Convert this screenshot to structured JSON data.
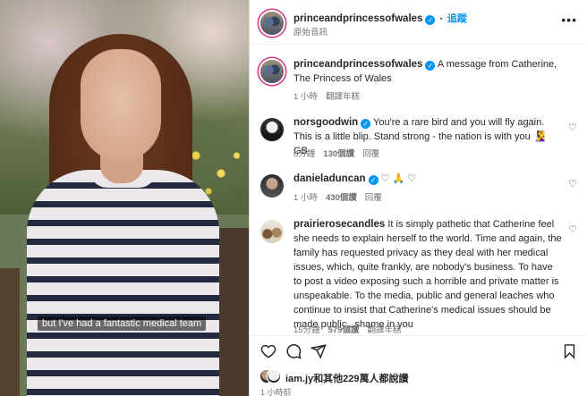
{
  "post": {
    "caption_overlay": "but I've had a fantastic medical team"
  },
  "header": {
    "username": "princeandprincessofwales",
    "follow_label": "追蹤",
    "follow_separator": "•",
    "subtitle": "原始音訊",
    "more_label": "•••"
  },
  "caption": {
    "username": "princeandprincessofwales",
    "text": "A message from Catherine, The Princess of Wales",
    "time": "1 小時",
    "translate": "翻譯年糕"
  },
  "comments": [
    {
      "username": "norsgoodwin",
      "verified": true,
      "text": "You're a rare bird and you will fly again. This is a little blip. Stand strong - the nation is with you 🧏‍♀️ GB",
      "time": "8分鐘",
      "likes": "130個讚",
      "reply": "回覆"
    },
    {
      "username": "danieladuncan",
      "verified": true,
      "text": "♡ 🙏 ♡",
      "time": "1 小時",
      "likes": "430個讚",
      "reply": "回覆"
    },
    {
      "username": "prairierosecandles",
      "verified": false,
      "text": "It is simply pathetic that Catherine feel she needs to explain herself to the world. Time and again, the family has requested privacy as they deal with her medical issues, which, quite frankly, are nobody's business. To have to post a video exposing such a horrible and private matter is unspeakable. To the media, public and general leaches who continue to insist that Catherine's medical issues should be made public...shame in you",
      "time": "15分鐘",
      "likes": "579個讚",
      "reply": "翻譯年糕"
    }
  ],
  "likes_line": {
    "username": "iam.jy",
    "rest": "和其他229萬人都說讚"
  },
  "post_time": "1 小時前",
  "icons": {
    "like": "heart-icon",
    "comment": "comment-icon",
    "share": "share-icon",
    "save": "bookmark-icon"
  },
  "colors": {
    "accent": "#0095f6",
    "text": "#262626",
    "muted": "#737373"
  }
}
